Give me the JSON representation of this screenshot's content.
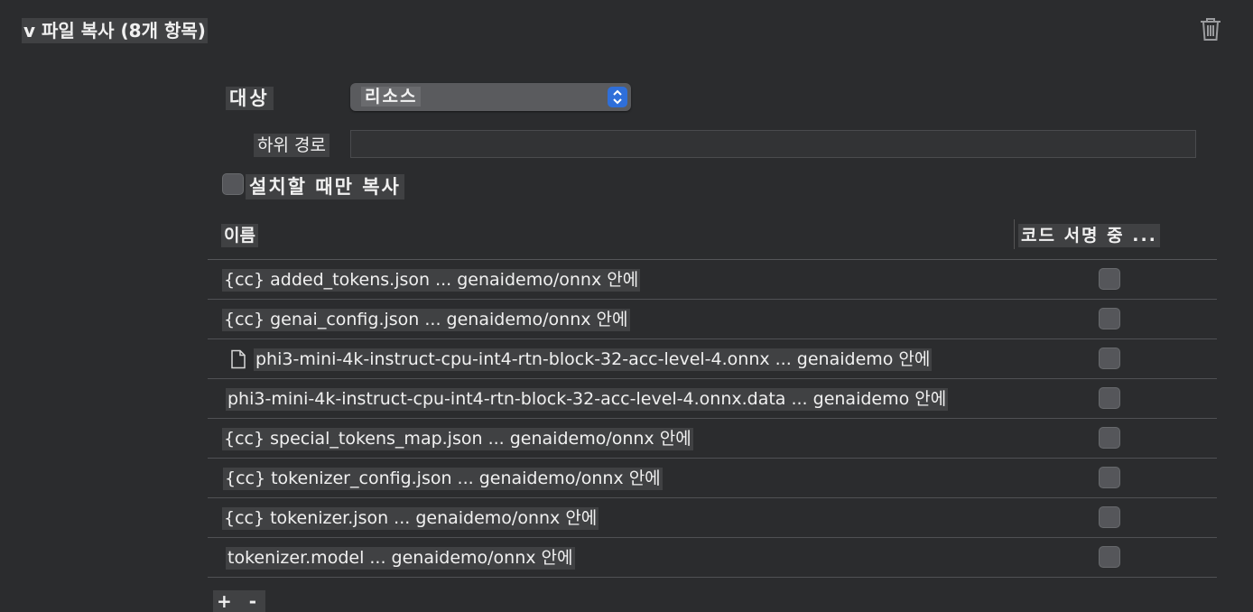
{
  "header": {
    "title": "v 파일 복사 (8개 항목)"
  },
  "icons": {
    "delete": "trash-icon",
    "file": "document-icon",
    "stepper": "up-down-chevron-icon"
  },
  "colors": {
    "background": "#2b2c2e",
    "accent": "#2f6fd9"
  },
  "target": {
    "label": "대상",
    "value": "리소스"
  },
  "subpath": {
    "label": "하위 경로",
    "value": ""
  },
  "install_only": {
    "label": "설치할 때만 복사",
    "checked": false
  },
  "table": {
    "columns": {
      "name": "이름",
      "code_sign": "코드 서명 중 ..."
    },
    "rows": [
      {
        "name": "{cc} added_tokens.json ... genaidemo/onnx 안에",
        "signed": false
      },
      {
        "name": "{cc} genai_config.json ... genaidemo/onnx 안에",
        "signed": false
      },
      {
        "name": "phi3-mini-4k-instruct-cpu-int4-rtn-block-32-acc-level-4.onnx ... genaidemo 안에",
        "signed": false,
        "icon": "document-icon"
      },
      {
        "name": "phi3-mini-4k-instruct-cpu-int4-rtn-block-32-acc-level-4.onnx.data ... genaidemo 안에",
        "signed": false
      },
      {
        "name": "{cc} special_tokens_map.json ... genaidemo/onnx 안에",
        "signed": false
      },
      {
        "name": "{cc} tokenizer_config.json ... genaidemo/onnx 안에",
        "signed": false
      },
      {
        "name": "{cc} tokenizer.json ... genaidemo/onnx 안에",
        "signed": false
      },
      {
        "name": "tokenizer.model ... genaidemo/onnx 안에",
        "signed": false
      }
    ]
  },
  "footer": {
    "partial_label": "+ -"
  }
}
